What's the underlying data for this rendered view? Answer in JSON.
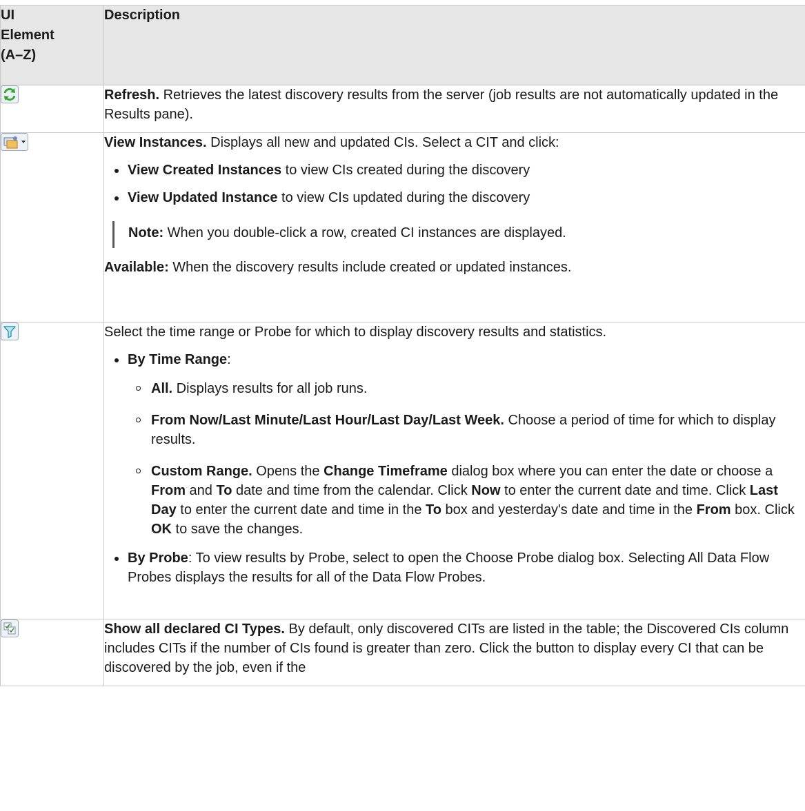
{
  "header": {
    "col1_line1": "UI",
    "col1_line2": "Element",
    "col1_line3": "(A–Z)",
    "col2": "Description"
  },
  "rows": [
    {
      "icon": "refresh-icon",
      "title": "Refresh.",
      "text": " Retrieves the latest discovery results from the server (job results are not automatically updated in the Results pane)."
    },
    {
      "icon": "view-instances-icon",
      "title": "View Instances.",
      "text": " Displays all new and updated CIs. Select a CIT and click:",
      "bullets": [
        {
          "title": "View Created Instances",
          "text": " to view CIs created during the discovery"
        },
        {
          "title": "View Updated Instance",
          "text": " to view CIs updated during the discovery"
        }
      ],
      "note_label": "Note:",
      "note_text": "  When you double-click a row, created CI instances are displayed.",
      "available_label": "Available:",
      "available_text": " When the discovery results include created or updated instances."
    },
    {
      "icon": "filter-icon",
      "text": "Select the time range or Probe for which to display discovery results and statistics.",
      "bullet1_title": "By Time Range",
      "bullet1_text": ":",
      "sub": [
        {
          "title": "All.",
          "text": " Displays results for all job runs."
        },
        {
          "title": "From Now/Last Minute/Last Hour/Last Day/Last Week.",
          "text": " Choose a period of time for which to display results."
        }
      ],
      "custom": {
        "t1": "Custom Range.",
        "s1": " Opens the ",
        "t2": "Change Timeframe",
        "s2": " dialog box where you can enter the date or choose a ",
        "t3": "From",
        "s3": " and ",
        "t4": "To",
        "s4": " date and time from the calendar. Click ",
        "t5": "Now",
        "s5": " to enter the current date and time. Click ",
        "t6": "Last Day",
        "s6": " to enter the current date and time in the ",
        "t7": "To",
        "s7": " box and yesterday's date and time in the ",
        "t8": "From",
        "s8": " box. Click ",
        "t9": "OK",
        "s9": " to save the changes."
      },
      "bullet2_title": "By Probe",
      "bullet2_text": ": To view results by Probe, select to open the Choose Probe dialog box. Selecting All Data Flow Probes displays the results for all of the Data Flow Probes."
    },
    {
      "icon": "show-all-types-icon",
      "title": "Show all declared CI Types.",
      "text": " By default, only discovered CITs are listed in the table; the Discovered CIs column includes CITs if the number of CIs found is greater than zero. Click the button to display every CI that can be discovered by the job, even if the"
    }
  ],
  "colors": {
    "header_bg": "#e6e6e6",
    "border": "#c8c8c8",
    "refresh_green": "#3aa63a",
    "filter_teal": "#2a9db0"
  }
}
